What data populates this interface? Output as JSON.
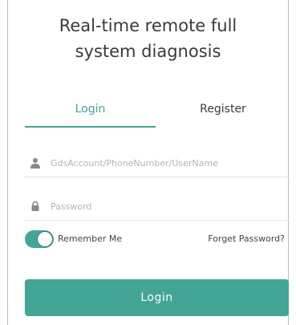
{
  "title": {
    "line1": "Real-time remote full",
    "line2": "system diagnosis"
  },
  "tabs": {
    "login": "Login",
    "register": "Register",
    "active": "Login"
  },
  "fields": {
    "account": {
      "placeholder": "GdsAccount/PhoneNumber/UserName",
      "icon": "user-icon"
    },
    "password": {
      "placeholder": "Password",
      "icon": "lock-icon"
    }
  },
  "remember_me": {
    "label": "Remember Me",
    "checked": true
  },
  "forgot_password": "Forget Password?",
  "login_button": "Login",
  "colors": {
    "accent": "#43a595",
    "text": "#3a3a3a",
    "placeholder": "#b4b4b4",
    "divider": "#e3e3e3"
  }
}
